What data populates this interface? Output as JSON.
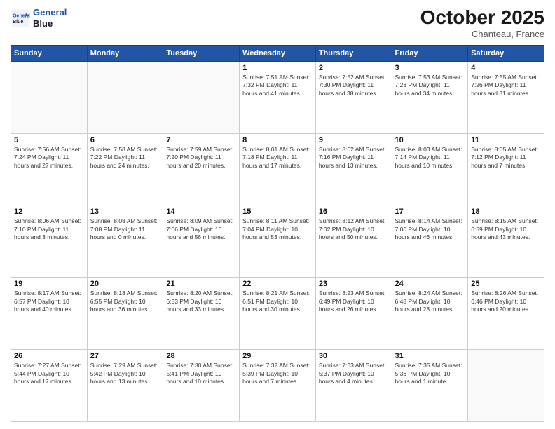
{
  "header": {
    "logo_line1": "General",
    "logo_line2": "Blue",
    "month": "October 2025",
    "location": "Chanteau, France"
  },
  "days": [
    "Sunday",
    "Monday",
    "Tuesday",
    "Wednesday",
    "Thursday",
    "Friday",
    "Saturday"
  ],
  "weeks": [
    [
      {
        "date": "",
        "info": ""
      },
      {
        "date": "",
        "info": ""
      },
      {
        "date": "",
        "info": ""
      },
      {
        "date": "1",
        "info": "Sunrise: 7:51 AM\nSunset: 7:32 PM\nDaylight: 11 hours\nand 41 minutes."
      },
      {
        "date": "2",
        "info": "Sunrise: 7:52 AM\nSunset: 7:30 PM\nDaylight: 11 hours\nand 38 minutes."
      },
      {
        "date": "3",
        "info": "Sunrise: 7:53 AM\nSunset: 7:28 PM\nDaylight: 11 hours\nand 34 minutes."
      },
      {
        "date": "4",
        "info": "Sunrise: 7:55 AM\nSunset: 7:26 PM\nDaylight: 11 hours\nand 31 minutes."
      }
    ],
    [
      {
        "date": "5",
        "info": "Sunrise: 7:56 AM\nSunset: 7:24 PM\nDaylight: 11 hours\nand 27 minutes."
      },
      {
        "date": "6",
        "info": "Sunrise: 7:58 AM\nSunset: 7:22 PM\nDaylight: 11 hours\nand 24 minutes."
      },
      {
        "date": "7",
        "info": "Sunrise: 7:59 AM\nSunset: 7:20 PM\nDaylight: 11 hours\nand 20 minutes."
      },
      {
        "date": "8",
        "info": "Sunrise: 8:01 AM\nSunset: 7:18 PM\nDaylight: 11 hours\nand 17 minutes."
      },
      {
        "date": "9",
        "info": "Sunrise: 8:02 AM\nSunset: 7:16 PM\nDaylight: 11 hours\nand 13 minutes."
      },
      {
        "date": "10",
        "info": "Sunrise: 8:03 AM\nSunset: 7:14 PM\nDaylight: 11 hours\nand 10 minutes."
      },
      {
        "date": "11",
        "info": "Sunrise: 8:05 AM\nSunset: 7:12 PM\nDaylight: 11 hours\nand 7 minutes."
      }
    ],
    [
      {
        "date": "12",
        "info": "Sunrise: 8:06 AM\nSunset: 7:10 PM\nDaylight: 11 hours\nand 3 minutes."
      },
      {
        "date": "13",
        "info": "Sunrise: 8:08 AM\nSunset: 7:08 PM\nDaylight: 11 hours\nand 0 minutes."
      },
      {
        "date": "14",
        "info": "Sunrise: 8:09 AM\nSunset: 7:06 PM\nDaylight: 10 hours\nand 56 minutes."
      },
      {
        "date": "15",
        "info": "Sunrise: 8:11 AM\nSunset: 7:04 PM\nDaylight: 10 hours\nand 53 minutes."
      },
      {
        "date": "16",
        "info": "Sunrise: 8:12 AM\nSunset: 7:02 PM\nDaylight: 10 hours\nand 50 minutes."
      },
      {
        "date": "17",
        "info": "Sunrise: 8:14 AM\nSunset: 7:00 PM\nDaylight: 10 hours\nand 46 minutes."
      },
      {
        "date": "18",
        "info": "Sunrise: 8:15 AM\nSunset: 6:59 PM\nDaylight: 10 hours\nand 43 minutes."
      }
    ],
    [
      {
        "date": "19",
        "info": "Sunrise: 8:17 AM\nSunset: 6:57 PM\nDaylight: 10 hours\nand 40 minutes."
      },
      {
        "date": "20",
        "info": "Sunrise: 8:18 AM\nSunset: 6:55 PM\nDaylight: 10 hours\nand 36 minutes."
      },
      {
        "date": "21",
        "info": "Sunrise: 8:20 AM\nSunset: 6:53 PM\nDaylight: 10 hours\nand 33 minutes."
      },
      {
        "date": "22",
        "info": "Sunrise: 8:21 AM\nSunset: 6:51 PM\nDaylight: 10 hours\nand 30 minutes."
      },
      {
        "date": "23",
        "info": "Sunrise: 8:23 AM\nSunset: 6:49 PM\nDaylight: 10 hours\nand 26 minutes."
      },
      {
        "date": "24",
        "info": "Sunrise: 8:24 AM\nSunset: 6:48 PM\nDaylight: 10 hours\nand 23 minutes."
      },
      {
        "date": "25",
        "info": "Sunrise: 8:26 AM\nSunset: 6:46 PM\nDaylight: 10 hours\nand 20 minutes."
      }
    ],
    [
      {
        "date": "26",
        "info": "Sunrise: 7:27 AM\nSunset: 5:44 PM\nDaylight: 10 hours\nand 17 minutes."
      },
      {
        "date": "27",
        "info": "Sunrise: 7:29 AM\nSunset: 5:42 PM\nDaylight: 10 hours\nand 13 minutes."
      },
      {
        "date": "28",
        "info": "Sunrise: 7:30 AM\nSunset: 5:41 PM\nDaylight: 10 hours\nand 10 minutes."
      },
      {
        "date": "29",
        "info": "Sunrise: 7:32 AM\nSunset: 5:39 PM\nDaylight: 10 hours\nand 7 minutes."
      },
      {
        "date": "30",
        "info": "Sunrise: 7:33 AM\nSunset: 5:37 PM\nDaylight: 10 hours\nand 4 minutes."
      },
      {
        "date": "31",
        "info": "Sunrise: 7:35 AM\nSunset: 5:36 PM\nDaylight: 10 hours\nand 1 minute."
      },
      {
        "date": "",
        "info": ""
      }
    ]
  ]
}
